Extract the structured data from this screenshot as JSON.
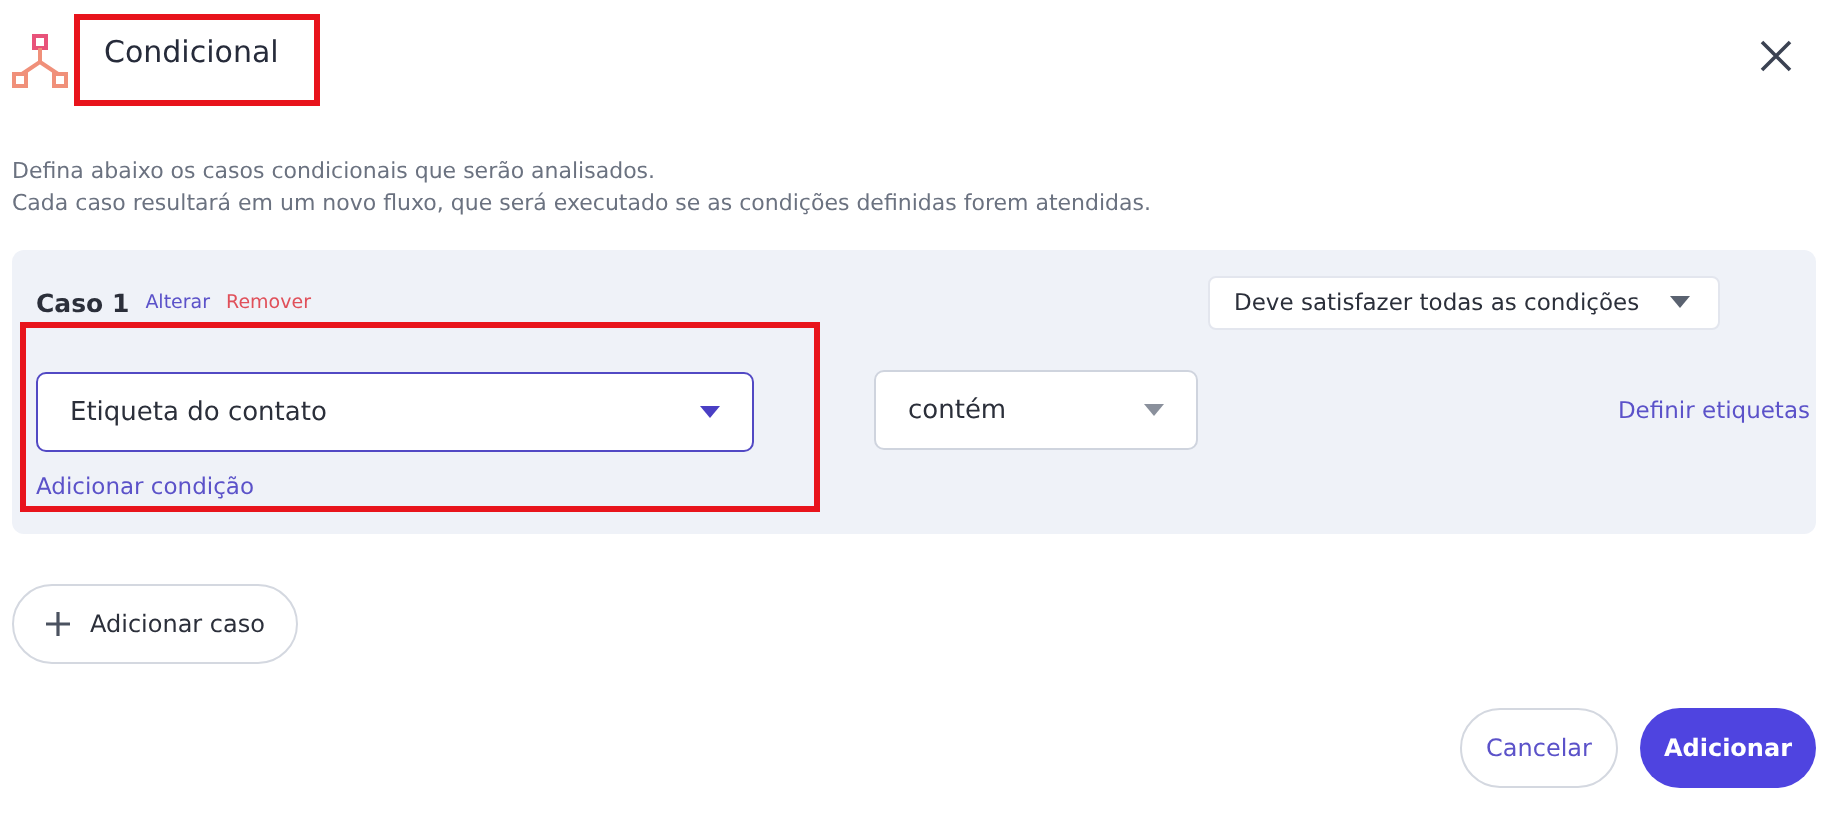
{
  "dialog": {
    "title": "Condicional",
    "description": [
      "Defina abaixo os casos condicionais que serão analisados.",
      "Cada caso resultará em um novo fluxo, que será executado se as condições definidas forem atendidas."
    ]
  },
  "cases": [
    {
      "title": "Caso 1",
      "edit_link": "Alterar",
      "remove_link": "Remover",
      "match_mode": "Deve satisfazer todas as condições",
      "conditions": [
        {
          "field": {
            "value": "Etiqueta do contato",
            "focused": true
          },
          "operator": {
            "value": "contém",
            "focused": false
          },
          "action_link": "Definir etiquetas"
        }
      ],
      "add_condition_link": "Adicionar condição"
    }
  ],
  "add_case_button": "Adicionar caso",
  "footer": {
    "cancel": "Cancelar",
    "confirm": "Adicionar"
  }
}
